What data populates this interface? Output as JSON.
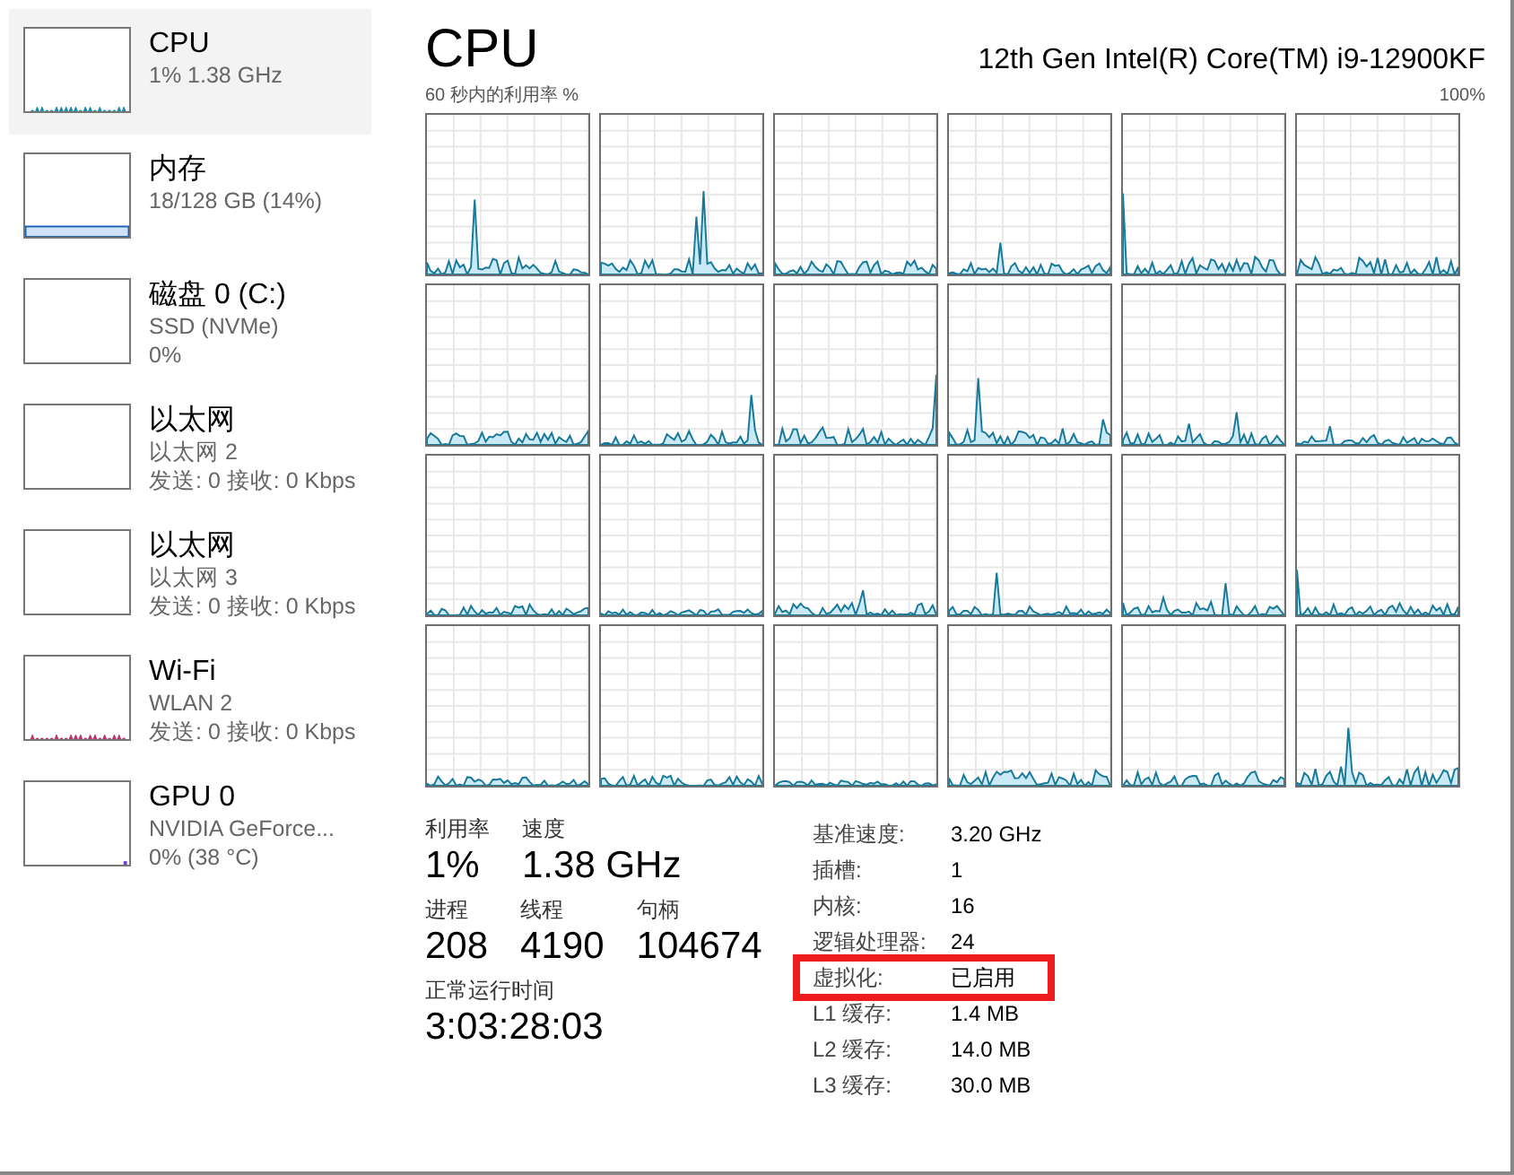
{
  "sidebar": {
    "items": [
      {
        "kind": "cpu",
        "title": "CPU",
        "lines": [
          "1% 1.38 GHz"
        ],
        "selected": true
      },
      {
        "kind": "memory",
        "title": "内存",
        "lines": [
          "18/128 GB (14%)"
        ],
        "selected": false
      },
      {
        "kind": "disk",
        "title": "磁盘 0 (C:)",
        "lines": [
          "SSD (NVMe)",
          "0%"
        ],
        "selected": false
      },
      {
        "kind": "ethernet",
        "title": "以太网",
        "lines": [
          "以太网 2",
          "发送: 0 接收: 0 Kbps"
        ],
        "selected": false
      },
      {
        "kind": "ethernet",
        "title": "以太网",
        "lines": [
          "以太网 3",
          "发送: 0 接收: 0 Kbps"
        ],
        "selected": false
      },
      {
        "kind": "wifi",
        "title": "Wi-Fi",
        "lines": [
          "WLAN 2",
          "发送: 0 接收: 0 Kbps"
        ],
        "selected": false
      },
      {
        "kind": "gpu",
        "title": "GPU 0",
        "lines": [
          "NVIDIA GeForce...",
          "0% (38 °C)"
        ],
        "selected": false
      }
    ]
  },
  "header": {
    "title": "CPU",
    "model": "12th Gen Intel(R) Core(TM) i9-12900KF",
    "graph_caption": "60 秒内的利用率 %",
    "graph_max": "100%"
  },
  "processor_graphs": [
    {
      "kind": "picture"
    },
    {
      "kind": "picture"
    },
    {
      "kind": "picture"
    },
    {
      "kind": "picture"
    },
    {
      "kind": "picture"
    },
    {
      "kind": "picture"
    },
    {
      "kind": "picture"
    },
    {
      "kind": "picture"
    },
    {
      "kind": "picture"
    },
    {
      "kind": "picture"
    },
    {
      "kind": "picture"
    },
    {
      "kind": "picture"
    },
    {
      "kind": "picture"
    },
    {
      "kind": "picture"
    },
    {
      "kind": "picture"
    },
    {
      "kind": "picture"
    },
    {
      "kind": "picture"
    },
    {
      "kind": "picture"
    },
    {
      "kind": "picture"
    },
    {
      "kind": "picture"
    },
    {
      "kind": "picture"
    },
    {
      "kind": "picture"
    },
    {
      "kind": "picture"
    },
    {
      "kind": "picture"
    }
  ],
  "stats": [
    [
      {
        "label": "利用率",
        "value": "1%"
      },
      {
        "label": "速度",
        "value": "1.38 GHz"
      }
    ],
    [
      {
        "label": "进程",
        "value": "208"
      },
      {
        "label": "线程",
        "value": "4190"
      },
      {
        "label": "句柄",
        "value": "104674"
      }
    ],
    [
      {
        "label": "正常运行时间",
        "value": "3:03:28:03"
      }
    ]
  ],
  "details": [
    {
      "label": "基准速度:",
      "value": "3.20 GHz",
      "highlighted": false
    },
    {
      "label": "插槽:",
      "value": "1",
      "highlighted": false
    },
    {
      "label": "内核:",
      "value": "16",
      "highlighted": false
    },
    {
      "label": "逻辑处理器:",
      "value": "24",
      "highlighted": false
    },
    {
      "label": "虚拟化:",
      "value": "已启用",
      "highlighted": true
    },
    {
      "label": "L1 缓存:",
      "value": "1.4 MB",
      "highlighted": false
    },
    {
      "label": "L2 缓存:",
      "value": "14.0 MB",
      "highlighted": false
    },
    {
      "label": "L3 缓存:",
      "value": "30.0 MB",
      "highlighted": false
    }
  ]
}
